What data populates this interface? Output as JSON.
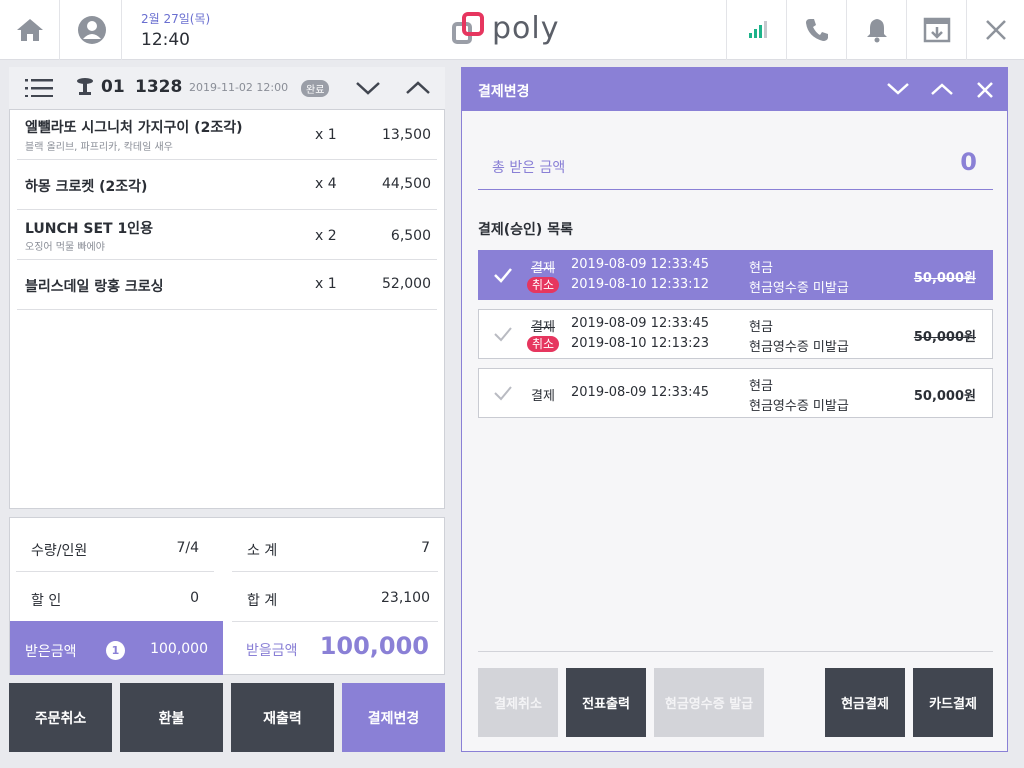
{
  "topbar": {
    "date": "2월 27일(목)",
    "time": "12:40",
    "logo_text": "poly",
    "icons": [
      "home-icon",
      "user-icon",
      "signal-icon",
      "phone-icon",
      "bell-icon",
      "download-icon",
      "close-icon"
    ],
    "signal_color": "#1db38a"
  },
  "order": {
    "table_no": "01",
    "order_no": "1328",
    "datetime": "2019-11-02  12:00",
    "status": "완료",
    "items": [
      {
        "name": "엘뺄라또 시그니처 가지구이 (2조각)",
        "sub": "블랙 올리브, 파프리카, 칵테일 새우",
        "qty": "x 1",
        "price": "13,500"
      },
      {
        "name": "하몽 크로켓 (2조각)",
        "sub": "",
        "qty": "x 4",
        "price": "44,500"
      },
      {
        "name": "LUNCH SET 1인용",
        "sub": "오징어 먹물 빠에야",
        "qty": "x 2",
        "price": "6,500"
      },
      {
        "name": "블리스데일 랑홍 크로싱",
        "sub": "",
        "qty": "x 1",
        "price": "52,000"
      }
    ]
  },
  "summary": {
    "qty_label": "수량/인원",
    "qty_value": "7/4",
    "subtotal_label": "소    계",
    "subtotal_value": "7",
    "discount_label": "할    인",
    "discount_value": "0",
    "total_label": "합    계",
    "total_value": "23,100",
    "received_label": "받은금액",
    "received_count": "1",
    "received_value": "100,000",
    "to_receive_label": "받을금액",
    "to_receive_value": "100,000"
  },
  "bottom_buttons": [
    "주문취소",
    "환불",
    "재출력",
    "결제변경"
  ],
  "payment_panel": {
    "title": "결제변경",
    "total_received_label": "총 받은 금액",
    "total_received_value": "0",
    "list_title": "결제(승인) 목록",
    "rows": [
      {
        "type": "결제",
        "cancel": "취소",
        "date1": "2019-08-09  12:33:45",
        "date2": "2019-08-10  12:33:12",
        "method": "현금",
        "receipt": "현금영수증 미발급",
        "amount": "50,000원"
      },
      {
        "type": "결제",
        "cancel": "취소",
        "date1": "2019-08-09  12:33:45",
        "date2": "2019-08-10  12:13:23",
        "method": "현금",
        "receipt": "현금영수증 미발급",
        "amount": "50,000원"
      },
      {
        "type": "결제",
        "date1": "2019-08-09  12:33:45",
        "method": "현금",
        "receipt": "현금영수증 미발급",
        "amount": "50,000원"
      }
    ],
    "buttons": {
      "cancel_payment": "결제취소",
      "print_slip": "전표출력",
      "cash_receipt": "현금영수증 발급",
      "cash_pay": "현금결제",
      "card_pay": "카드결제"
    }
  },
  "colors": {
    "accent": "#8a80d6",
    "dark_button": "#414650",
    "cancel_badge": "#e6365f"
  }
}
